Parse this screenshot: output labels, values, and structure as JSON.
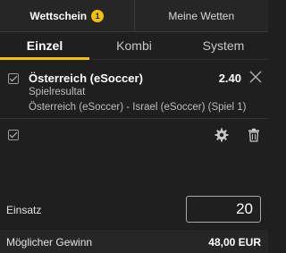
{
  "top_tabs": {
    "betslip_label": "Wettschein",
    "betslip_count": "1",
    "my_bets_label": "Meine Wetten"
  },
  "sub_tabs": [
    {
      "label": "Einzel",
      "active": true
    },
    {
      "label": "Kombi",
      "active": false
    },
    {
      "label": "System",
      "active": false
    }
  ],
  "bet": {
    "selection": "Österreich (eSoccer)",
    "odds": "2.40",
    "market": "Spielresultat",
    "event": "Österreich (eSoccer) - Israel (eSoccer) (Spiel 1)"
  },
  "stake": {
    "label": "Einsatz",
    "value": "20"
  },
  "potential_win": {
    "label": "Möglicher Gewinn",
    "value": "48,00 EUR"
  },
  "colors": {
    "accent": "#f2c200",
    "background": "#1f1f1f"
  },
  "icons": [
    "checkbox-icon",
    "close-icon",
    "gear-icon",
    "trash-icon"
  ]
}
